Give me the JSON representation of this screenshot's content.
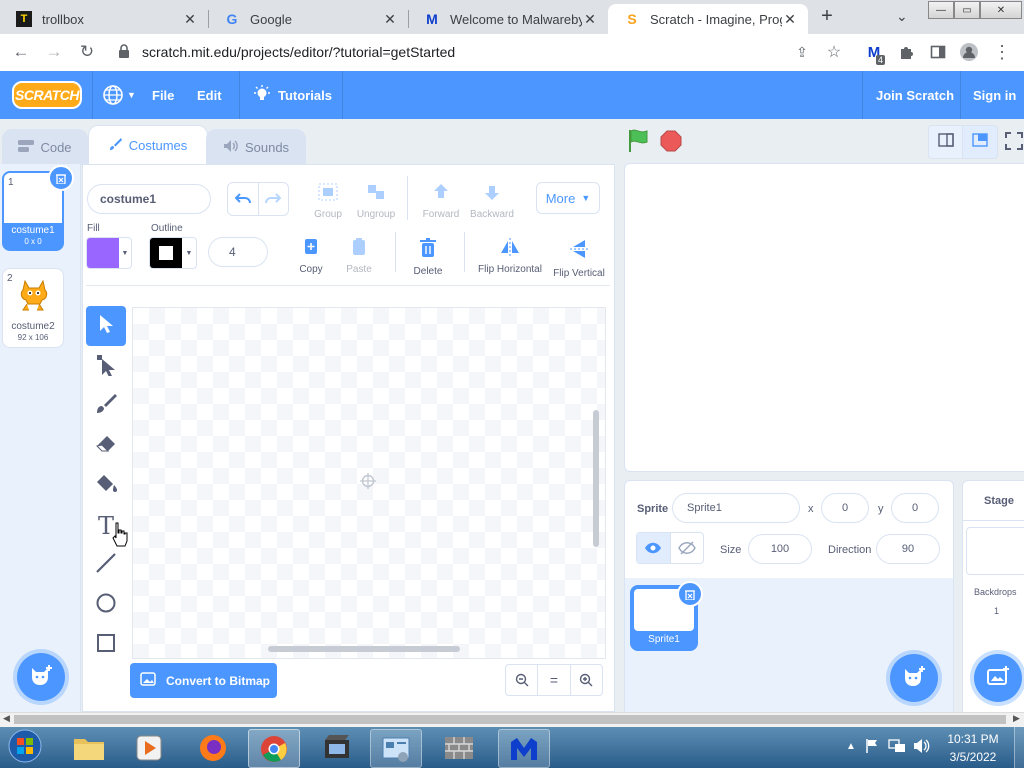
{
  "browser": {
    "tabs": [
      {
        "title": "trollbox"
      },
      {
        "title": "Google"
      },
      {
        "title": "Welcome to Malwarebyte"
      },
      {
        "title": "Scratch - Imagine, Progra"
      }
    ],
    "new_tab": "+",
    "address": "scratch.mit.edu/projects/editor/?tutorial=getStarted",
    "extension_badge": "4"
  },
  "scratch": {
    "logo": "SCRATCH",
    "menu": {
      "file": "File",
      "edit": "Edit",
      "tutorials": "Tutorials",
      "join": "Join Scratch",
      "signin": "Sign in"
    },
    "editor_tabs": {
      "code": "Code",
      "costumes": "Costumes",
      "sounds": "Sounds"
    },
    "costumes": [
      {
        "index": "1",
        "name": "costume1",
        "size": "0 x 0"
      },
      {
        "index": "2",
        "name": "costume2",
        "size": "92 x 106"
      }
    ],
    "paint": {
      "costume_name": "costume1",
      "fill_label": "Fill",
      "outline_label": "Outline",
      "fill_color": "#9966ff",
      "outline_color": "#000000",
      "outline_width": "4",
      "group": "Group",
      "ungroup": "Ungroup",
      "forward": "Forward",
      "backward": "Backward",
      "more": "More",
      "copy": "Copy",
      "paste": "Paste",
      "delete": "Delete",
      "flip_h": "Flip Horizontal",
      "flip_v": "Flip Vertical",
      "convert": "Convert to Bitmap",
      "zoom_reset": "="
    },
    "sprite_info": {
      "sprite_label": "Sprite",
      "sprite_name": "Sprite1",
      "x_label": "x",
      "x": "0",
      "y_label": "y",
      "y": "0",
      "size_label": "Size",
      "size": "100",
      "direction_label": "Direction",
      "direction": "90"
    },
    "sprites": [
      {
        "name": "Sprite1"
      }
    ],
    "stage": {
      "title": "Stage",
      "backdrops_label": "Backdrops",
      "backdrops_count": "1"
    },
    "accent": "#4c97ff"
  },
  "taskbar": {
    "time": "10:31 PM",
    "date": "3/5/2022"
  }
}
